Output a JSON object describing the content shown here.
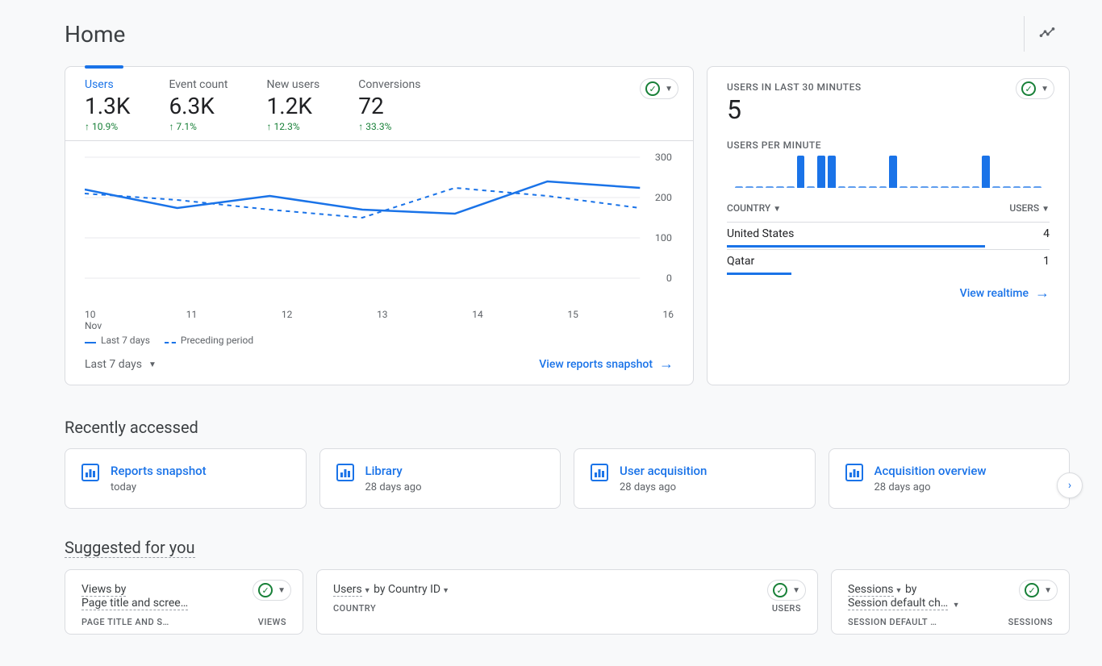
{
  "page": {
    "title": "Home"
  },
  "main_card": {
    "metrics": [
      {
        "label": "Users",
        "value": "1.3K",
        "delta": "↑ 10.9%",
        "active": true
      },
      {
        "label": "Event count",
        "value": "6.3K",
        "delta": "↑ 7.1%"
      },
      {
        "label": "New users",
        "value": "1.2K",
        "delta": "↑ 12.3%"
      },
      {
        "label": "Conversions",
        "value": "72",
        "delta": "↑ 33.3%"
      }
    ],
    "date_range": "Last 7 days",
    "snapshot_link": "View reports snapshot",
    "legend": {
      "current": "Last 7 days",
      "prev": "Preceding period"
    },
    "x_month": "Nov"
  },
  "realtime": {
    "heading": "USERS IN LAST 30 MINUTES",
    "value": "5",
    "sub": "USERS PER MINUTE",
    "table": {
      "col1": "COUNTRY",
      "col2": "USERS",
      "rows": [
        {
          "name": "United States",
          "count": "4",
          "pct": 80
        },
        {
          "name": "Qatar",
          "count": "1",
          "pct": 20
        }
      ]
    },
    "link": "View realtime"
  },
  "recent": {
    "heading": "Recently accessed",
    "items": [
      {
        "title": "Reports snapshot",
        "when": "today"
      },
      {
        "title": "Library",
        "when": "28 days ago"
      },
      {
        "title": "User acquisition",
        "when": "28 days ago"
      },
      {
        "title": "Acquisition overview",
        "when": "28 days ago"
      }
    ]
  },
  "suggested": {
    "heading": "Suggested for you",
    "cards": [
      {
        "title_pre": "Views by",
        "title_dim": "Page title and scree…",
        "col1": "PAGE TITLE AND S…",
        "col2": "VIEWS"
      },
      {
        "title_metric": "Users",
        "title_mid": " by Country ID",
        "col1": "COUNTRY",
        "col2": "USERS"
      },
      {
        "title_metric": "Sessions",
        "title_mid": " by",
        "title_dim": "Session default ch…",
        "col1": "SESSION DEFAULT …",
        "col2": "SESSIONS"
      }
    ]
  },
  "chart_data": {
    "type": "line",
    "x": [
      "10",
      "11",
      "12",
      "13",
      "14",
      "15",
      "16"
    ],
    "x_month": "Nov",
    "ylim": [
      0,
      300
    ],
    "yticks": [
      0,
      100,
      200,
      300
    ],
    "series": [
      {
        "name": "Last 7 days",
        "style": "solid",
        "values": [
          220,
          175,
          205,
          170,
          160,
          240,
          225
        ]
      },
      {
        "name": "Preceding period",
        "style": "dashed",
        "values": [
          210,
          195,
          170,
          150,
          225,
          205,
          175
        ]
      }
    ],
    "realtime_bars": [
      0,
      0,
      0,
      0,
      0,
      0,
      1,
      0,
      1,
      1,
      0,
      0,
      0,
      0,
      0,
      1,
      0,
      0,
      0,
      0,
      0,
      0,
      0,
      0,
      1,
      0,
      0,
      0,
      0,
      0
    ]
  }
}
